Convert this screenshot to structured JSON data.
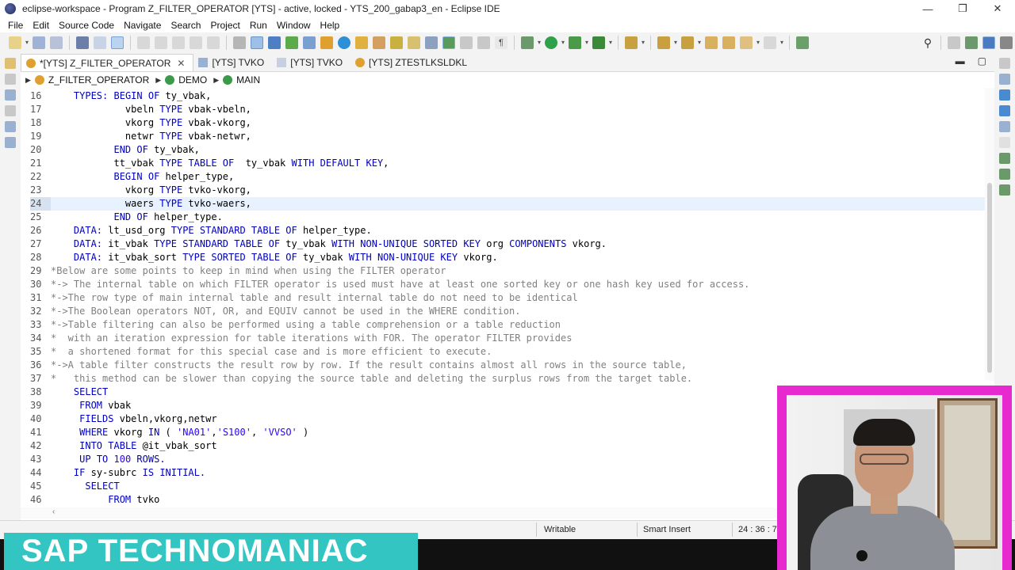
{
  "window": {
    "title": "eclipse-workspace - Program Z_FILTER_OPERATOR [YTS] - active, locked - YTS_200_gabap3_en - Eclipse IDE",
    "minimize": "—",
    "maximize": "❐",
    "close": "✕"
  },
  "menubar": [
    "File",
    "Edit",
    "Source Code",
    "Navigate",
    "Search",
    "Project",
    "Run",
    "Window",
    "Help"
  ],
  "tabs": [
    {
      "label": "*[YTS] Z_FILTER_OPERATOR",
      "close": "✕",
      "active": true
    },
    {
      "label": "[YTS] TVKO",
      "active": false
    },
    {
      "label": "[YTS] TVKO",
      "active": false
    },
    {
      "label": "[YTS] ZTESTLKSLDKL",
      "active": false
    }
  ],
  "breadcrumb": [
    "Z_FILTER_OPERATOR",
    "DEMO",
    "MAIN"
  ],
  "editor": {
    "current_line": "24",
    "lines": [
      {
        "n": "16",
        "t": "    TYPES: BEGIN OF ty_vbak,"
      },
      {
        "n": "17",
        "t": "             vbeln TYPE vbak-vbeln,"
      },
      {
        "n": "18",
        "t": "             vkorg TYPE vbak-vkorg,"
      },
      {
        "n": "19",
        "t": "             netwr TYPE vbak-netwr,"
      },
      {
        "n": "20",
        "t": "           END OF ty_vbak,"
      },
      {
        "n": "21",
        "t": "           tt_vbak TYPE TABLE OF  ty_vbak WITH DEFAULT KEY,"
      },
      {
        "n": "22",
        "t": "           BEGIN OF helper_type,"
      },
      {
        "n": "23",
        "t": "             vkorg TYPE tvko-vkorg,"
      },
      {
        "n": "24",
        "t": "             waers TYPE tvko-waers,"
      },
      {
        "n": "25",
        "t": "           END OF helper_type."
      },
      {
        "n": "26",
        "t": "    DATA: lt_usd_org TYPE STANDARD TABLE OF helper_type."
      },
      {
        "n": "27",
        "t": "    DATA: it_vbak TYPE STANDARD TABLE OF ty_vbak WITH NON-UNIQUE SORTED KEY org COMPONENTS vkorg."
      },
      {
        "n": "28",
        "t": "    DATA: it_vbak_sort TYPE SORTED TABLE OF ty_vbak WITH NON-UNIQUE KEY vkorg."
      },
      {
        "n": "29",
        "t": "*Below are some points to keep in mind when using the FILTER operator"
      },
      {
        "n": "30",
        "t": "*-> The internal table on which FILTER operator is used must have at least one sorted key or one hash key used for access."
      },
      {
        "n": "31",
        "t": "*->The row type of main internal table and result internal table do not need to be identical"
      },
      {
        "n": "32",
        "t": "*->The Boolean operators NOT, OR, and EQUIV cannot be used in the WHERE condition."
      },
      {
        "n": "33",
        "t": "*->Table filtering can also be performed using a table comprehension or a table reduction"
      },
      {
        "n": "34",
        "t": "*  with an iteration expression for table iterations with FOR. The operator FILTER provides"
      },
      {
        "n": "35",
        "t": "*  a shortened format for this special case and is more efficient to execute."
      },
      {
        "n": "36",
        "t": "*->A table filter constructs the result row by row. If the result contains almost all rows in the source table,"
      },
      {
        "n": "37",
        "t": "*   this method can be slower than copying the source table and deleting the surplus rows from the target table."
      },
      {
        "n": "38",
        "t": "    SELECT"
      },
      {
        "n": "39",
        "t": "     FROM vbak"
      },
      {
        "n": "40",
        "t": "     FIELDS vbeln,vkorg,netwr"
      },
      {
        "n": "41",
        "t": "     WHERE vkorg IN ( 'NA01','S100', 'VVSO' )"
      },
      {
        "n": "42",
        "t": "     INTO TABLE @it_vbak_sort"
      },
      {
        "n": "43",
        "t": "     UP TO 100 ROWS."
      },
      {
        "n": "44",
        "t": "    IF sy-subrc IS INITIAL."
      },
      {
        "n": "45",
        "t": "      SELECT"
      },
      {
        "n": "46",
        "t": "          FROM tvko"
      }
    ]
  },
  "status": {
    "writable": "Writable",
    "insert_mode": "Smart Insert",
    "position": "24 : 36 : 74"
  },
  "watermark": "SAP TECHNOMANIAC",
  "colors": {
    "keyword": "#7f0055",
    "keyword_blue": "#0000c0",
    "comment": "#808080",
    "string": "#2a00ff",
    "current_line": "#e8f2fe",
    "watermark_bg": "#33c5c2",
    "webcam_frame": "#e62ad0"
  }
}
